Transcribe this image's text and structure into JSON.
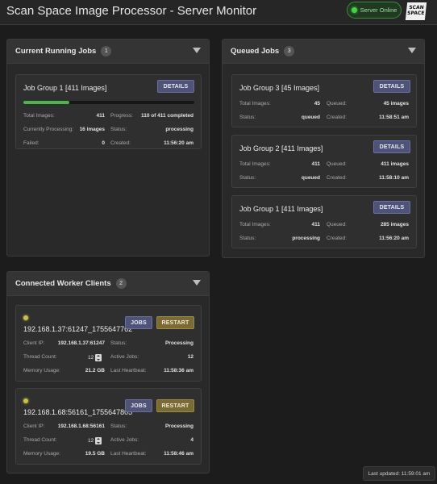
{
  "header": {
    "title": "Scan Space Image Processor - Server Monitor",
    "server_status": "Server Online",
    "logo_line1": "SCAN",
    "logo_line2": "SPACE",
    "status_color": "#45d045"
  },
  "running": {
    "title": "Current Running Jobs",
    "count": "1",
    "jobs": [
      {
        "name": "Job Group 1 [411 Images]",
        "details_label": "DETAILS",
        "progress_fraction": 0.268,
        "total_images_label": "Total Images:",
        "total_images": "411",
        "progress_label": "Progress:",
        "progress": "110 of 411 completed",
        "processing_label": "Currently Processing:",
        "processing": "16 images",
        "status_label": "Status:",
        "status": "processing",
        "failed_label": "Failed:",
        "failed": "0",
        "created_label": "Created:",
        "created": "11:56:20 am"
      }
    ]
  },
  "queued": {
    "title": "Queued Jobs",
    "count": "3",
    "jobs": [
      {
        "name": "Job Group 3 [45 Images]",
        "details_label": "DETAILS",
        "total_images_label": "Total Images:",
        "total_images": "45",
        "queued_label": "Queued:",
        "queued": "45 images",
        "status_label": "Status:",
        "status": "queued",
        "created_label": "Created:",
        "created": "11:58:51 am"
      },
      {
        "name": "Job Group 2 [411 Images]",
        "details_label": "DETAILS",
        "total_images_label": "Total Images:",
        "total_images": "411",
        "queued_label": "Queued:",
        "queued": "411 images",
        "status_label": "Status:",
        "status": "queued",
        "created_label": "Created:",
        "created": "11:58:10 am"
      },
      {
        "name": "Job Group 1 [411 Images]",
        "details_label": "DETAILS",
        "total_images_label": "Total Images:",
        "total_images": "411",
        "queued_label": "Queued:",
        "queued": "285 images",
        "status_label": "Status:",
        "status": "processing",
        "created_label": "Created:",
        "created": "11:56:20 am"
      }
    ]
  },
  "clients": {
    "title": "Connected Worker Clients",
    "count": "2",
    "items": [
      {
        "name": "192.168.1.37:61247_1755647762",
        "jobs_label": "JOBS",
        "restart_label": "RESTART",
        "client_ip_label": "Client IP:",
        "client_ip": "192.168.1.37:61247",
        "status_label": "Status:",
        "status": "Processing",
        "thread_count_label": "Thread Count:",
        "thread_count": "12",
        "active_jobs_label": "Active Jobs:",
        "active_jobs": "12",
        "memory_label": "Memory Usage:",
        "memory": "21.2 GB",
        "heartbeat_label": "Last Heartbeat:",
        "heartbeat": "11:58:36 am"
      },
      {
        "name": "192.168.1.68:56161_1755647805",
        "jobs_label": "JOBS",
        "restart_label": "RESTART",
        "client_ip_label": "Client IP:",
        "client_ip": "192.168.1.68:56161",
        "status_label": "Status:",
        "status": "Processing",
        "thread_count_label": "Thread Count:",
        "thread_count": "12",
        "active_jobs_label": "Active Jobs:",
        "active_jobs": "4",
        "memory_label": "Memory Usage:",
        "memory": "19.5 GB",
        "heartbeat_label": "Last Heartbeat:",
        "heartbeat": "11:58:46 am"
      }
    ]
  },
  "footer": {
    "last_updated": "Last updated: 11:59:01 am"
  }
}
